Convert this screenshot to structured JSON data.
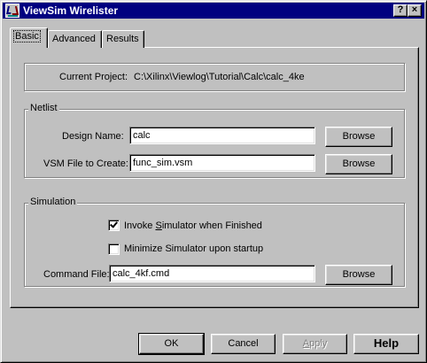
{
  "window": {
    "title": "ViewSim Wirelister",
    "help_button": "?",
    "close_button": "×"
  },
  "tabs": [
    {
      "label": "Basic",
      "selected": true
    },
    {
      "label": "Advanced",
      "selected": false
    },
    {
      "label": "Results",
      "selected": false
    }
  ],
  "project": {
    "label": "Current Project:",
    "value": "C:\\Xilinx\\Viewlog\\Tutorial\\Calc\\calc_4ke"
  },
  "netlist": {
    "group_label": "Netlist",
    "design_name_label": "Design  Name:",
    "design_name_value": "calc",
    "vsm_label": "VSM File to Create:",
    "vsm_value": "func_sim.vsm",
    "browse_label": "Browse"
  },
  "simulation": {
    "group_label": "Simulation",
    "invoke": {
      "label_prefix": "Invoke ",
      "label_ul": "S",
      "label_rest": "imulator when Finished",
      "checked": true
    },
    "minimize": {
      "label": "Minimize Simulator upon startup",
      "checked": false
    },
    "command_label": "Command File:",
    "command_value": "calc_4kf.cmd",
    "browse_label": "Browse"
  },
  "footer": {
    "ok": "OK",
    "cancel": "Cancel",
    "apply_ul": "A",
    "apply_rest": "pply",
    "help": "Help"
  }
}
